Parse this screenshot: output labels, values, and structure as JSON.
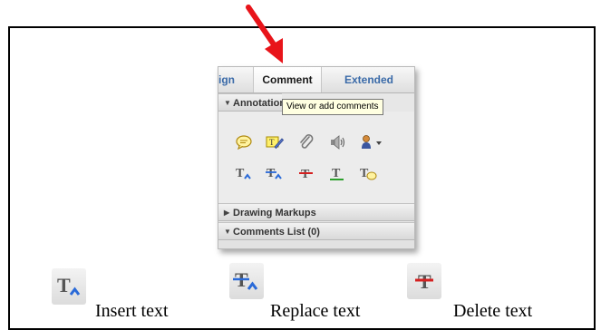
{
  "panel": {
    "tabs": [
      {
        "label": "Sign"
      },
      {
        "label": "Comment"
      },
      {
        "label": "Extended"
      }
    ],
    "annotations_header": "Annotations",
    "tooltip": "View or add comments",
    "tool_icons_row1": [
      "sticky-note-icon",
      "highlight-text-icon",
      "attach-file-icon",
      "record-audio-icon",
      "stamp-icon"
    ],
    "tool_icons_row2": [
      "insert-text-icon",
      "replace-text-icon",
      "strikethrough-icon",
      "underline-text-icon",
      "text-comment-icon"
    ],
    "drawing_markups_header": "Drawing Markups",
    "comments_list_header": "Comments List (0)"
  },
  "legend": {
    "insert_label": "Insert text",
    "replace_label": "Replace text",
    "delete_label": "Delete text"
  },
  "colors": {
    "arrow": "#e8141a",
    "tab_link": "#3a6aa8",
    "tooltip_bg": "#ffffe1"
  }
}
